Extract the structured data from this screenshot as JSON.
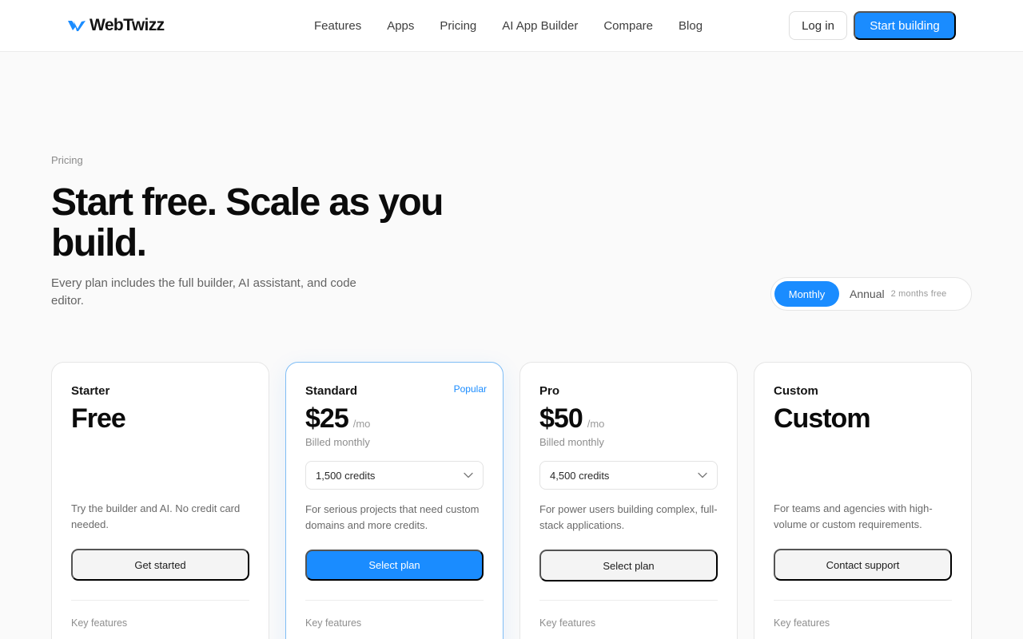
{
  "header": {
    "brand": "WebTwizz",
    "nav": [
      "Features",
      "Apps",
      "Pricing",
      "AI App Builder",
      "Compare",
      "Blog"
    ],
    "login_label": "Log in",
    "start_label": "Start building"
  },
  "hero": {
    "eyebrow": "Pricing",
    "headline": "Start free. Scale as you build.",
    "subhead": "Every plan includes the full builder, AI assistant, and code editor."
  },
  "billing_toggle": {
    "monthly_label": "Monthly",
    "annual_label": "Annual",
    "annual_note": "2 months free",
    "selected": "Monthly"
  },
  "plans": [
    {
      "name": "Starter",
      "price": "Free",
      "period": "",
      "billed": "",
      "credits": "",
      "description": "Try the builder and AI. No credit card needed.",
      "cta": "Get started",
      "features_label": "Key features"
    },
    {
      "name": "Standard",
      "badge": "Popular",
      "price": "$25",
      "period": "/mo",
      "billed": "Billed monthly",
      "credits": "1,500 credits",
      "description": "For serious projects that need custom domains and more credits.",
      "cta": "Select plan",
      "features_label": "Key features"
    },
    {
      "name": "Pro",
      "price": "$50",
      "period": "/mo",
      "billed": "Billed monthly",
      "credits": "4,500 credits",
      "description": "For power users building complex, full-stack applications.",
      "cta": "Select plan",
      "features_label": "Key features"
    },
    {
      "name": "Custom",
      "price": "Custom",
      "period": "",
      "billed": "",
      "credits": "",
      "description": "For teams and agencies with high-volume or custom requirements.",
      "cta": "Contact support",
      "features_label": "Key features"
    }
  ],
  "colors": {
    "accent": "#1a8cff",
    "background": "#fafafa",
    "card_border": "#e6e6e6",
    "featured_border": "#7fbdf5"
  },
  "icons": {
    "logo": "double-chevron-logo-icon",
    "dropdown": "chevron-down-icon"
  }
}
